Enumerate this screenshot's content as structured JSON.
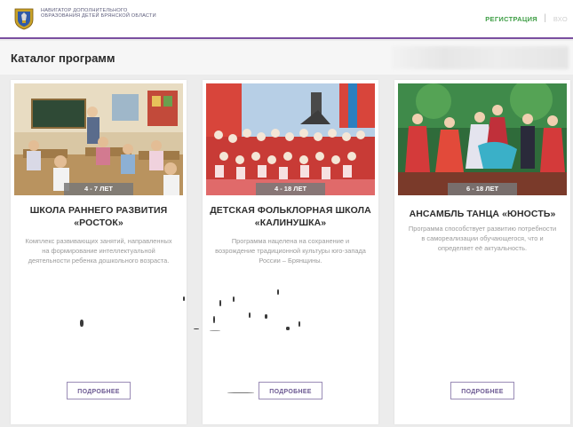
{
  "header": {
    "brand_text": "НАВИГАТОР ДОПОЛНИТЕЛЬНОГО ОБРАЗОВАНИЯ ДЕТЕЙ БРЯНСКОЙ ОБЛАСТИ",
    "register_label": "РЕГИСТРАЦИЯ",
    "separator": "|",
    "login_label": "ВХО",
    "logo_icon": "coat-of-arms-icon",
    "accent_color": "#7a4fa0",
    "register_color": "#3f9e46"
  },
  "page": {
    "title": "Каталог программ"
  },
  "cards": [
    {
      "age": "4 - 7 ЛЕТ",
      "title": "ШКОЛА РАННЕГО РАЗВИТИЯ «РОСТОК»",
      "description": "Комплекс развивающих занятий, направленных на формирование интеллектуальной деятельности ребенка дошкольного возраста.",
      "button_label": "ПОДРОБНЕЕ",
      "image": "classroom-photo"
    },
    {
      "age": "4 - 18 ЛЕТ",
      "title": "ДЕТСКАЯ ФОЛЬКЛОРНАЯ ШКОЛА «КАЛИНУШКА»",
      "description": "Программа нацелена на сохранение и возрождение традиционной культуры юго-запада России – Брянщины.",
      "button_label": "ПОДРОБНЕЕ",
      "image": "folk-choir-photo"
    },
    {
      "age": "6 - 18 ЛЕТ",
      "title": "АНСАМБЛЬ ТАНЦА «ЮНОСТЬ»",
      "description": "Программа способствует развитию потребности в самореализации обучающегося, что и определяет её актуальность.",
      "button_label": "ПОДРОБНЕЕ",
      "image": "folk-dance-photo"
    }
  ]
}
